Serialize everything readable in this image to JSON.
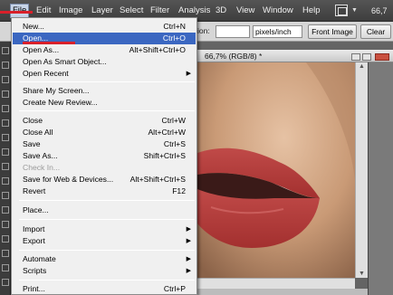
{
  "menubar": {
    "items": [
      "File",
      "Edit",
      "Image",
      "Layer",
      "Select",
      "Filter",
      "Analysis",
      "3D",
      "View",
      "Window",
      "Help"
    ],
    "zoom": "66,7"
  },
  "options": {
    "resolution_label": "ion:",
    "units_value": "pixels/inch",
    "front_image_label": "Front Image",
    "clear_label": "Clear"
  },
  "document": {
    "tab_title": "66,7% (RGB/8) *"
  },
  "file_menu": {
    "items": [
      {
        "label": "New...",
        "shortcut": "Ctrl+N"
      },
      {
        "label": "Open...",
        "shortcut": "Ctrl+O"
      },
      {
        "label": "Open As...",
        "shortcut": "Alt+Shift+Ctrl+O"
      },
      {
        "label": "Open As Smart Object...",
        "shortcut": ""
      },
      {
        "label": "Open Recent",
        "shortcut": ""
      },
      {
        "label": "Share My Screen...",
        "shortcut": ""
      },
      {
        "label": "Create New Review...",
        "shortcut": ""
      },
      {
        "label": "Close",
        "shortcut": "Ctrl+W"
      },
      {
        "label": "Close All",
        "shortcut": "Alt+Ctrl+W"
      },
      {
        "label": "Save",
        "shortcut": "Ctrl+S"
      },
      {
        "label": "Save As...",
        "shortcut": "Shift+Ctrl+S"
      },
      {
        "label": "Check In...",
        "shortcut": ""
      },
      {
        "label": "Save for Web & Devices...",
        "shortcut": "Alt+Shift+Ctrl+S"
      },
      {
        "label": "Revert",
        "shortcut": "F12"
      },
      {
        "label": "Place...",
        "shortcut": ""
      },
      {
        "label": "Import",
        "shortcut": ""
      },
      {
        "label": "Export",
        "shortcut": ""
      },
      {
        "label": "Automate",
        "shortcut": ""
      },
      {
        "label": "Scripts",
        "shortcut": ""
      },
      {
        "label": "Print...",
        "shortcut": "Ctrl+P"
      }
    ]
  },
  "colors": {
    "highlight": "#3b67c1",
    "annotation_red": "#d9202a"
  }
}
